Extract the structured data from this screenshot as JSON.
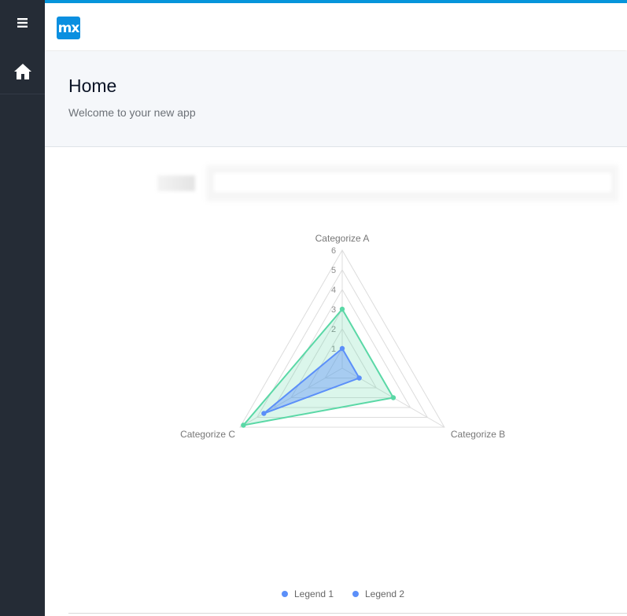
{
  "app": {
    "logo_text": "mx",
    "accent_color": "#0595db",
    "sidebar_color": "#252c36"
  },
  "sidebar": {
    "menu_icon": "hamburger-icon",
    "items": [
      {
        "icon": "home-icon"
      }
    ]
  },
  "header": {
    "title": "Home",
    "subtitle": "Welcome to your new app"
  },
  "chart_data": {
    "type": "radar",
    "indicators": [
      "Categorize A",
      "Categorize B",
      "Categorize C"
    ],
    "max": 6,
    "ticks": [
      "1",
      "2",
      "3",
      "4",
      "5",
      "6"
    ],
    "series": [
      {
        "name": "Legend 1",
        "values": [
          1,
          1,
          4.6
        ],
        "color": "#5b8ff9"
      },
      {
        "name": "Legend 2",
        "values": [
          3,
          3,
          5.8
        ],
        "color": "#5ad8a6"
      }
    ],
    "legend_position": "bottom"
  }
}
